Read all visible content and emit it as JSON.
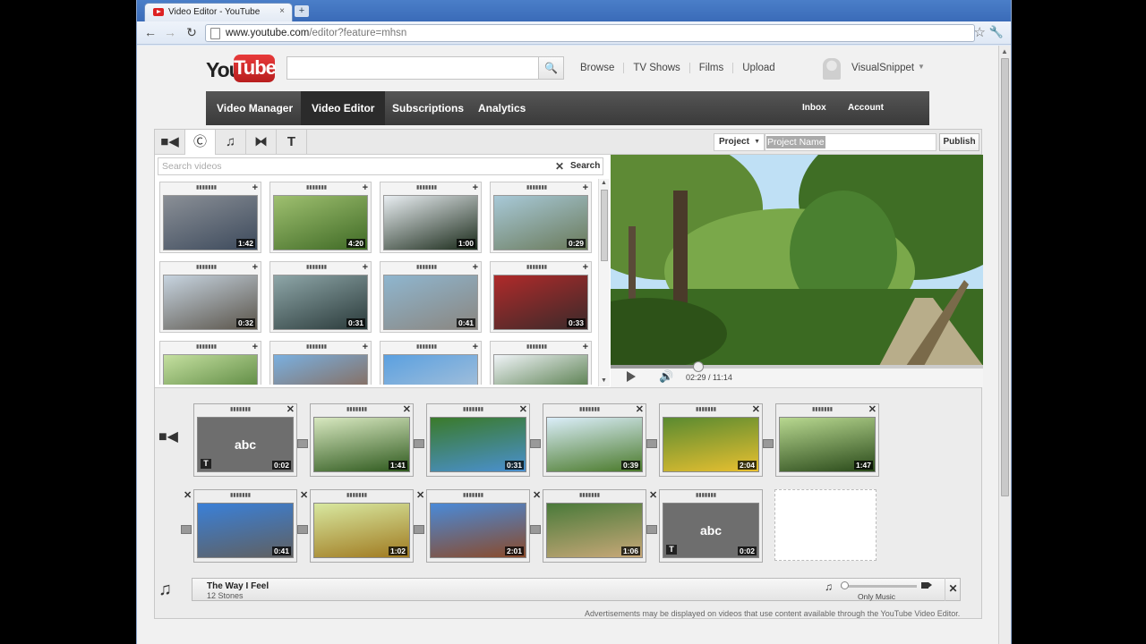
{
  "browser": {
    "tab_title": "Video Editor - YouTube",
    "tab_close": "×",
    "new_tab": "+",
    "url_host": "www.youtube.com",
    "url_path": "/editor?feature=mhsn"
  },
  "header": {
    "logo_you": "You",
    "logo_tube": "Tube",
    "search_placeholder": "",
    "nav": [
      "Browse",
      "TV Shows",
      "Films",
      "Upload"
    ],
    "username": "VisualSnippet"
  },
  "ytnav": {
    "items": [
      "Video Manager",
      "Video Editor",
      "Subscriptions",
      "Analytics"
    ],
    "right": [
      "Inbox",
      "Account Settings"
    ]
  },
  "editor": {
    "tools": [
      "camera",
      "cc",
      "music",
      "transition",
      "text"
    ],
    "project_label": "Project",
    "project_name": "Project Name",
    "publish": "Publish",
    "search_placeholder": "Search videos",
    "search_button": "Search",
    "library": [
      {
        "dur": "1:42",
        "c1": "#8a8f96",
        "c2": "#3d4a5c"
      },
      {
        "dur": "4:20",
        "c1": "#9fc070",
        "c2": "#3f6a25"
      },
      {
        "dur": "1:00",
        "c1": "#e9eef2",
        "c2": "#1a2a1a"
      },
      {
        "dur": "0:29",
        "c1": "#a8c9d8",
        "c2": "#6a7a5a"
      },
      {
        "dur": "0:32",
        "c1": "#c7d4e0",
        "c2": "#5a544a"
      },
      {
        "dur": "0:31",
        "c1": "#8ea6a8",
        "c2": "#2a3a3a"
      },
      {
        "dur": "0:41",
        "c1": "#8fb6cf",
        "c2": "#8a8680"
      },
      {
        "dur": "0:33",
        "c1": "#b02a2a",
        "c2": "#3a2a2a"
      },
      {
        "dur": "",
        "c1": "#c5e0a0",
        "c2": "#3e7026"
      },
      {
        "dur": "",
        "c1": "#7ab0e0",
        "c2": "#8a5a3a"
      },
      {
        "dur": "",
        "c1": "#5aa0e0",
        "c2": "#b8c8d8"
      },
      {
        "dur": "",
        "c1": "#f0f4f8",
        "c2": "#2a5a1a"
      }
    ],
    "time": "02:29 / 11:14",
    "progress": 0.235
  },
  "timeline": {
    "row1": [
      {
        "type": "title",
        "text": "abc",
        "dur": "0:02"
      },
      {
        "type": "video",
        "dur": "1:41",
        "c1": "#d8e8c0",
        "c2": "#2f5a1e"
      },
      {
        "type": "video",
        "dur": "0:31",
        "c1": "#3a7a2a",
        "c2": "#4a90d0"
      },
      {
        "type": "video",
        "dur": "0:39",
        "c1": "#dbeefa",
        "c2": "#4a7a2a"
      },
      {
        "type": "video",
        "dur": "2:04",
        "c1": "#5a8a30",
        "c2": "#e8c030"
      },
      {
        "type": "video",
        "dur": "1:47",
        "c1": "#b8d890",
        "c2": "#2a4a1a"
      }
    ],
    "row2": [
      {
        "type": "video",
        "dur": "0:41",
        "c1": "#3a80d8",
        "c2": "#606060"
      },
      {
        "type": "video",
        "dur": "1:02",
        "c1": "#d8e8a0",
        "c2": "#a07a20"
      },
      {
        "type": "video",
        "dur": "2:01",
        "c1": "#4a8ad8",
        "c2": "#8a4a2a"
      },
      {
        "type": "video",
        "dur": "1:06",
        "c1": "#4a7a3a",
        "c2": "#c8a878"
      },
      {
        "type": "title",
        "text": "abc",
        "dur": "0:02"
      }
    ],
    "audio_title": "The Way I Feel",
    "audio_artist": "12 Stones",
    "audio_mix": "Only Music",
    "ads_notice": "Advertisements may be displayed on videos that use content available through the YouTube Video Editor."
  }
}
